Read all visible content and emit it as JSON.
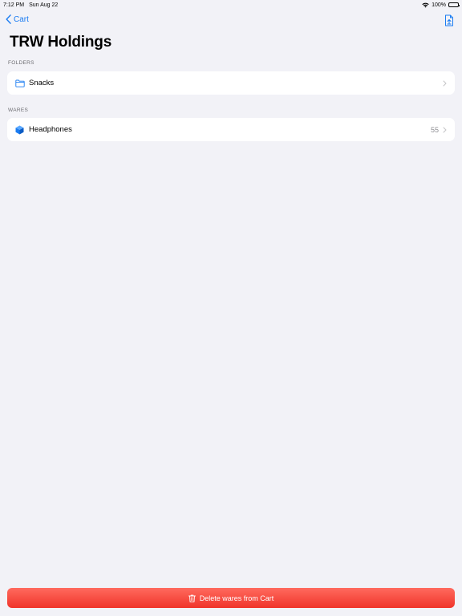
{
  "status_bar": {
    "time": "7:12 PM",
    "date": "Sun Aug 22",
    "battery_text": "100%",
    "wifi_icon": "wifi-icon",
    "battery_icon": "battery-icon"
  },
  "nav": {
    "back_label": "Cart",
    "back_icon": "chevron-left-icon",
    "share_icon": "share-icon"
  },
  "page": {
    "title": "TRW Holdings"
  },
  "sections": {
    "folders": {
      "header": "FOLDERS",
      "items": [
        {
          "label": "Snacks",
          "icon": "folder-icon"
        }
      ]
    },
    "wares": {
      "header": "WARES",
      "items": [
        {
          "label": "Headphones",
          "count": "55",
          "icon": "cube-icon"
        }
      ]
    }
  },
  "footer": {
    "delete_label": "Delete wares from Cart",
    "delete_icon": "trash-icon"
  },
  "colors": {
    "accent": "#1a7cf2",
    "background": "#f2f2f7",
    "destructive": "#f0342a"
  }
}
